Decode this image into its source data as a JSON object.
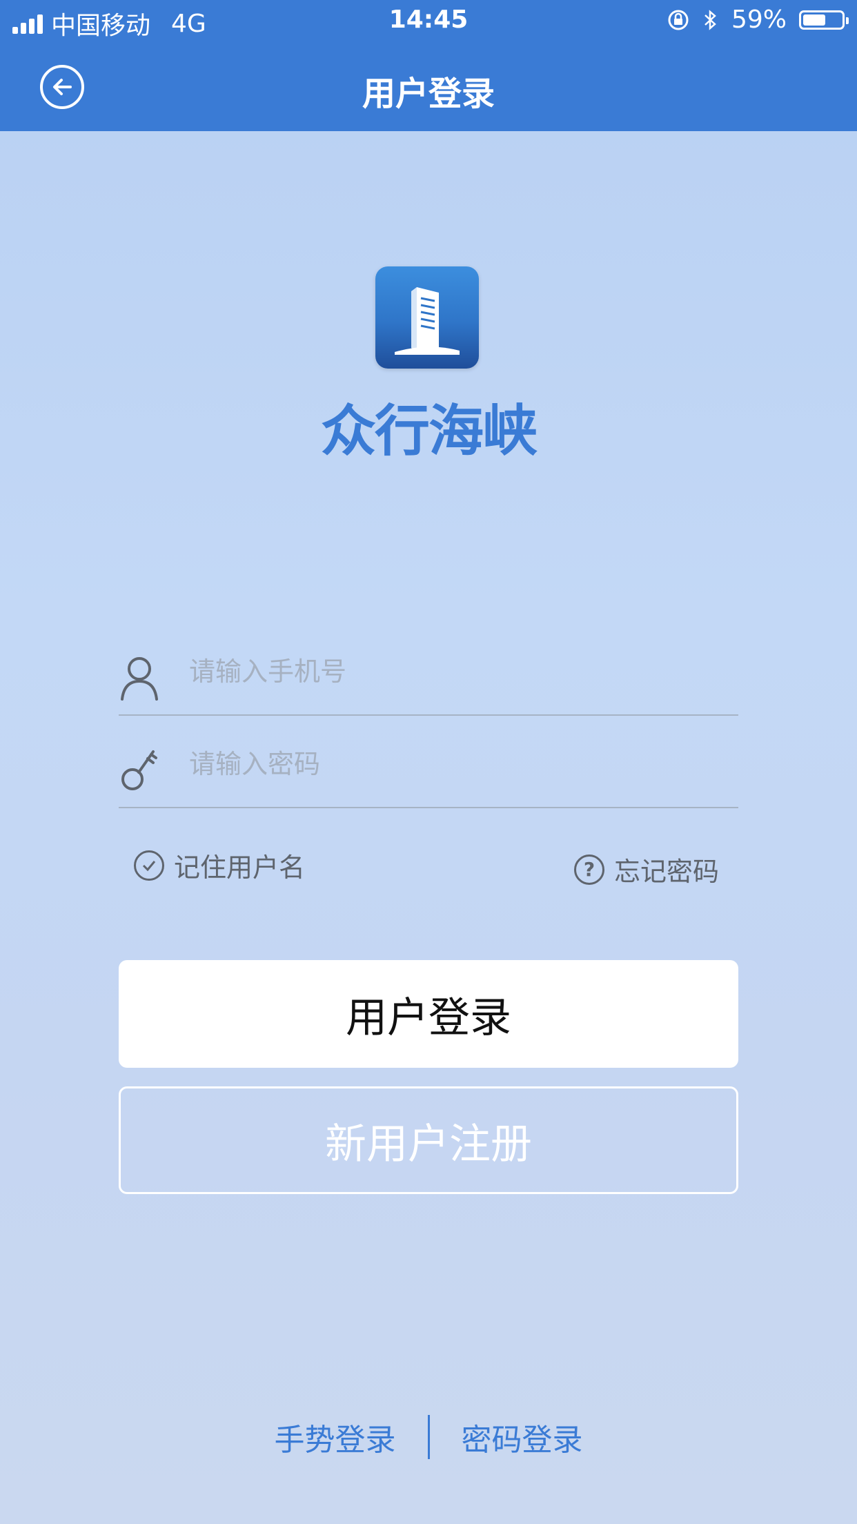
{
  "status_bar": {
    "carrier": "中国移动",
    "network": "4G",
    "time": "14:45",
    "battery": "59%",
    "battery_level": 0.59
  },
  "nav": {
    "title": "用户登录",
    "back_icon": "back-arrow-circle-icon"
  },
  "brand": {
    "name": "众行海峡",
    "logo_icon": "building-logo-icon"
  },
  "form": {
    "phone_placeholder": "请输入手机号",
    "password_placeholder": "请输入密码",
    "remember_label": "记住用户名",
    "forgot_label": "忘记密码",
    "login_button": "用户登录",
    "register_button": "新用户注册"
  },
  "footer": {
    "gesture_login": "手势登录",
    "password_login": "密码登录"
  },
  "colors": {
    "primary": "#3a7bd5",
    "background": "#c3d8f6",
    "text_muted": "#5e646d"
  }
}
